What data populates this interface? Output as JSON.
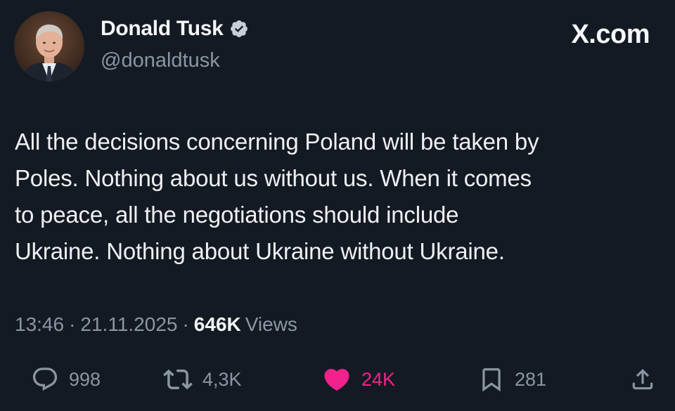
{
  "author": {
    "name": "Donald Tusk",
    "handle": "@donaldtusk",
    "verified": true,
    "avatar_icon": "profile-photo"
  },
  "brand": "X.com",
  "tweet": {
    "text": "All the decisions concerning Poland will be taken by\nPoles.  Nothing about us without us. When it comes\nto peace, all the negotiations should include\nUkraine. Nothing about Ukraine without Ukraine."
  },
  "meta": {
    "time": "13:46",
    "date": "21.11.2025",
    "separator": "·",
    "views_count": "646K",
    "views_label": "Views"
  },
  "actions": {
    "reply": {
      "count": "998",
      "icon": "reply-icon"
    },
    "retweet": {
      "count": "4,3K",
      "icon": "retweet-icon"
    },
    "like": {
      "count": "24K",
      "icon": "heart-icon",
      "active": true
    },
    "bookmark": {
      "count": "281",
      "icon": "bookmark-icon"
    },
    "share": {
      "icon": "share-icon"
    }
  },
  "colors": {
    "background": "#141a23",
    "text": "#eef0f3",
    "muted": "#8b96a3",
    "like": "#f3218b",
    "verified_badge": "#c9ced6"
  }
}
